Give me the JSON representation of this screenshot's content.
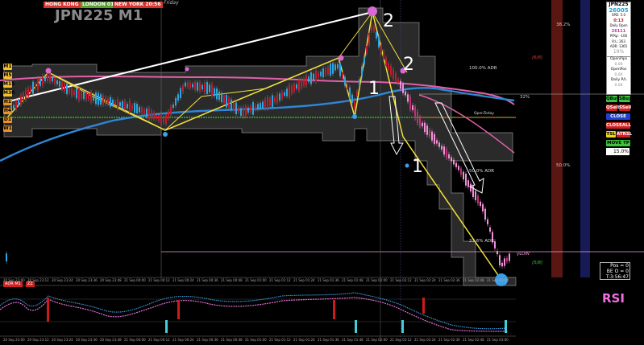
{
  "header": {
    "symbol_title": "JPN225 M1",
    "day_label": "Friday",
    "sessions": [
      {
        "label": "HONG KONG 08:56",
        "color": "#d4342b"
      },
      {
        "label": "LONDON 01:56",
        "color": "#5a9e2f"
      },
      {
        "label": "NEW YORK 20:56",
        "color": "#d4342b"
      }
    ]
  },
  "timeframes": [
    {
      "label": "M1",
      "color": "#f2c230"
    },
    {
      "label": "M5",
      "color": "#f2c230"
    },
    {
      "label": "M15",
      "color": "#f2c230"
    },
    {
      "label": "M30",
      "color": "#f2c230"
    },
    {
      "label": "H1",
      "color": "#e8942a"
    },
    {
      "label": "H4",
      "color": "#e8942a"
    },
    {
      "label": "D1",
      "color": "#e8942a"
    },
    {
      "label": "W1",
      "color": "#e8942a"
    }
  ],
  "chart_labels": {
    "fib_382": "38.2%",
    "fib_500": "50.0%",
    "adr_100": "100.0% ADR",
    "adr_500": "50.0% ADR",
    "adr_236": "23.6% ADR",
    "murrey_68": "[6/8]",
    "murrey_58": "[5/8]",
    "level_32": "32%",
    "open_today": "OpenToday",
    "ylow": "yLOW",
    "wave_numbers": [
      "2",
      "2",
      "1",
      "1"
    ]
  },
  "info_panel": {
    "symbol": "JPN225",
    "price": "26005",
    "spread": "SPD: 5.0",
    "timer": "0:13",
    "daily_open_label": "Daily Open",
    "daily_open": "26111",
    "pips_today": "PIPip: -106",
    "daily_range": "R:L: 263",
    "adr": "ADR: 1365",
    "pct": "19%",
    "open_pips_label": "OpenPips",
    "open_pips": "0.00",
    "open_pos_label": "OpenPos",
    "open_pos": "0.00",
    "daily_pl_label": "Daily P/L",
    "daily_pl": "0.00"
  },
  "buttons": {
    "qbuy": "QBuy",
    "sbuy": "SBuy",
    "qsell": "QSell",
    "ssell": "SSell",
    "close": "CLOSE",
    "closeall": "CLOSEALL",
    "tsl": "TSL",
    "atrsl": "ATRSL",
    "move_tp": "MOVE TP",
    "lot": "15.0%"
  },
  "position_box": {
    "pos": "Pos = 0",
    "be": "BE O = 0",
    "timer": "T:3:56:47"
  },
  "indicator": {
    "name": "RSI",
    "tab1": "ADR M1",
    "tab2": "ZZ"
  },
  "time_axis": [
    "20 Sep 23:00",
    "20 Sep 23:12",
    "20 Sep 23:24",
    "20 Sep 23:36",
    "20 Sep 23:48",
    "21 Sep 00:00",
    "21 Sep 00:12",
    "21 Sep 00:24",
    "21 Sep 00:36",
    "21 Sep 00:48",
    "21 Sep 01:00",
    "21 Sep 01:12",
    "21 Sep 01:24",
    "21 Sep 01:36",
    "21 Sep 01:48",
    "21 Sep 02:00",
    "21 Sep 02:12",
    "21 Sep 02:24",
    "21 Sep 02:36",
    "21 Sep 02:48",
    "21 Sep 03:00"
  ],
  "colors": {
    "background": "#000000",
    "channel_fill": "#262626",
    "ma_blue": "#2f86d6",
    "ma_pink": "#e060a8",
    "zigzag": "#f5e23a",
    "bull": "#2aa7e0",
    "bear": "#c8192b"
  }
}
